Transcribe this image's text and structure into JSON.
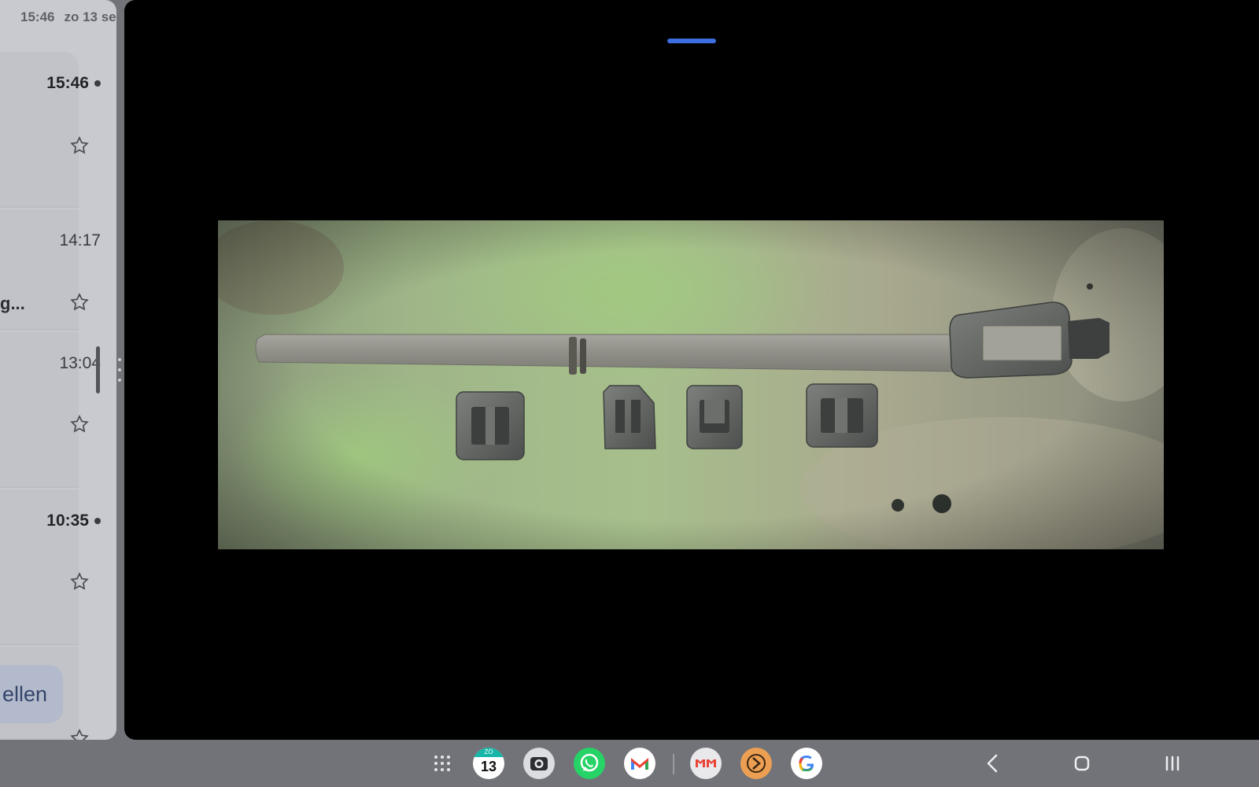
{
  "status_bar": {
    "time": "15:46",
    "date": "zo 13 se"
  },
  "mail_list": [
    {
      "time": "15:46",
      "unread": true
    },
    {
      "time": "14:17",
      "unread": false,
      "snippet": "g..."
    },
    {
      "time": "13:04",
      "unread": false
    },
    {
      "time": "10:35",
      "unread": true
    }
  ],
  "compose": {
    "label": "ellen"
  },
  "taskbar": {
    "apps": [
      {
        "name": "app-drawer-icon"
      },
      {
        "name": "calendar-icon",
        "day_label": "ZO",
        "day_number": "13"
      },
      {
        "name": "camera-icon"
      },
      {
        "name": "whatsapp-icon"
      },
      {
        "name": "gmail-icon"
      },
      {
        "name": "gmail-pair-icon"
      },
      {
        "name": "orange-app-icon"
      },
      {
        "name": "google-icon"
      }
    ],
    "nav": [
      "back-icon",
      "home-icon",
      "recents-icon"
    ]
  },
  "colors": {
    "accent_blue": "#3d6fe0",
    "compose_text": "#34446a",
    "compose_bg": "#b3bacc"
  }
}
